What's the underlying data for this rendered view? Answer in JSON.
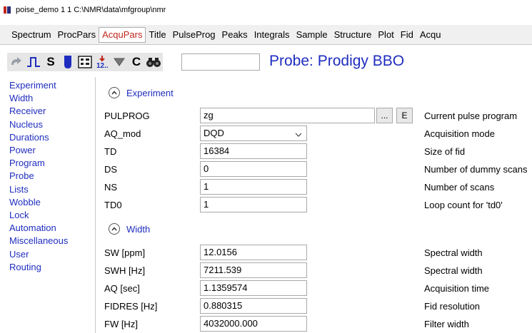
{
  "window": {
    "title": "poise_demo  1  1  C:\\NMR\\data\\mfgroup\\nmr"
  },
  "tabs": [
    {
      "label": "Spectrum"
    },
    {
      "label": "ProcPars"
    },
    {
      "label": "AcquPars"
    },
    {
      "label": "Title"
    },
    {
      "label": "PulseProg"
    },
    {
      "label": "Peaks"
    },
    {
      "label": "Integrals"
    },
    {
      "label": "Sample"
    },
    {
      "label": "Structure"
    },
    {
      "label": "Plot"
    },
    {
      "label": "Fid"
    },
    {
      "label": "Acqu"
    }
  ],
  "active_tab": "AcquPars",
  "toolbar": {
    "s_label": "S",
    "c_label": "C",
    "search_value": "",
    "probe_label": "Probe: Prodigy BBO"
  },
  "sidebar": {
    "items": [
      {
        "label": "Experiment"
      },
      {
        "label": "Width"
      },
      {
        "label": "Receiver"
      },
      {
        "label": "Nucleus"
      },
      {
        "label": "Durations"
      },
      {
        "label": "Power"
      },
      {
        "label": "Program"
      },
      {
        "label": "Probe"
      },
      {
        "label": "Lists"
      },
      {
        "label": "Wobble"
      },
      {
        "label": "Lock"
      },
      {
        "label": "Automation"
      },
      {
        "label": "Miscellaneous"
      },
      {
        "label": "User"
      },
      {
        "label": "Routing"
      }
    ]
  },
  "sections": {
    "experiment": {
      "label": "Experiment",
      "rows": [
        {
          "name": "PULPROG",
          "value": "zg",
          "desc": "Current pulse program",
          "btn1": "...",
          "btn2": "E"
        },
        {
          "name": "AQ_mod",
          "value": "DQD",
          "desc": "Acquisition mode"
        },
        {
          "name": "TD",
          "value": "16384",
          "desc": "Size of fid"
        },
        {
          "name": "DS",
          "value": "0",
          "desc": "Number of dummy scans"
        },
        {
          "name": "NS",
          "value": "1",
          "desc": "Number of scans"
        },
        {
          "name": "TD0",
          "value": "1",
          "desc": "Loop count for 'td0'"
        }
      ]
    },
    "width": {
      "label": "Width",
      "rows": [
        {
          "name": "SW [ppm]",
          "value": "12.0156",
          "desc": "Spectral width"
        },
        {
          "name": "SWH [Hz]",
          "value": "7211.539",
          "desc": "Spectral width"
        },
        {
          "name": "AQ [sec]",
          "value": "1.1359574",
          "desc": "Acquisition time"
        },
        {
          "name": "FIDRES [Hz]",
          "value": "0.880315",
          "desc": "Fid resolution"
        },
        {
          "name": "FW [Hz]",
          "value": "4032000.000",
          "desc": "Filter width"
        }
      ]
    }
  },
  "colors": {
    "accent": "#1f2dbf",
    "active_tab": "#c0271d"
  }
}
